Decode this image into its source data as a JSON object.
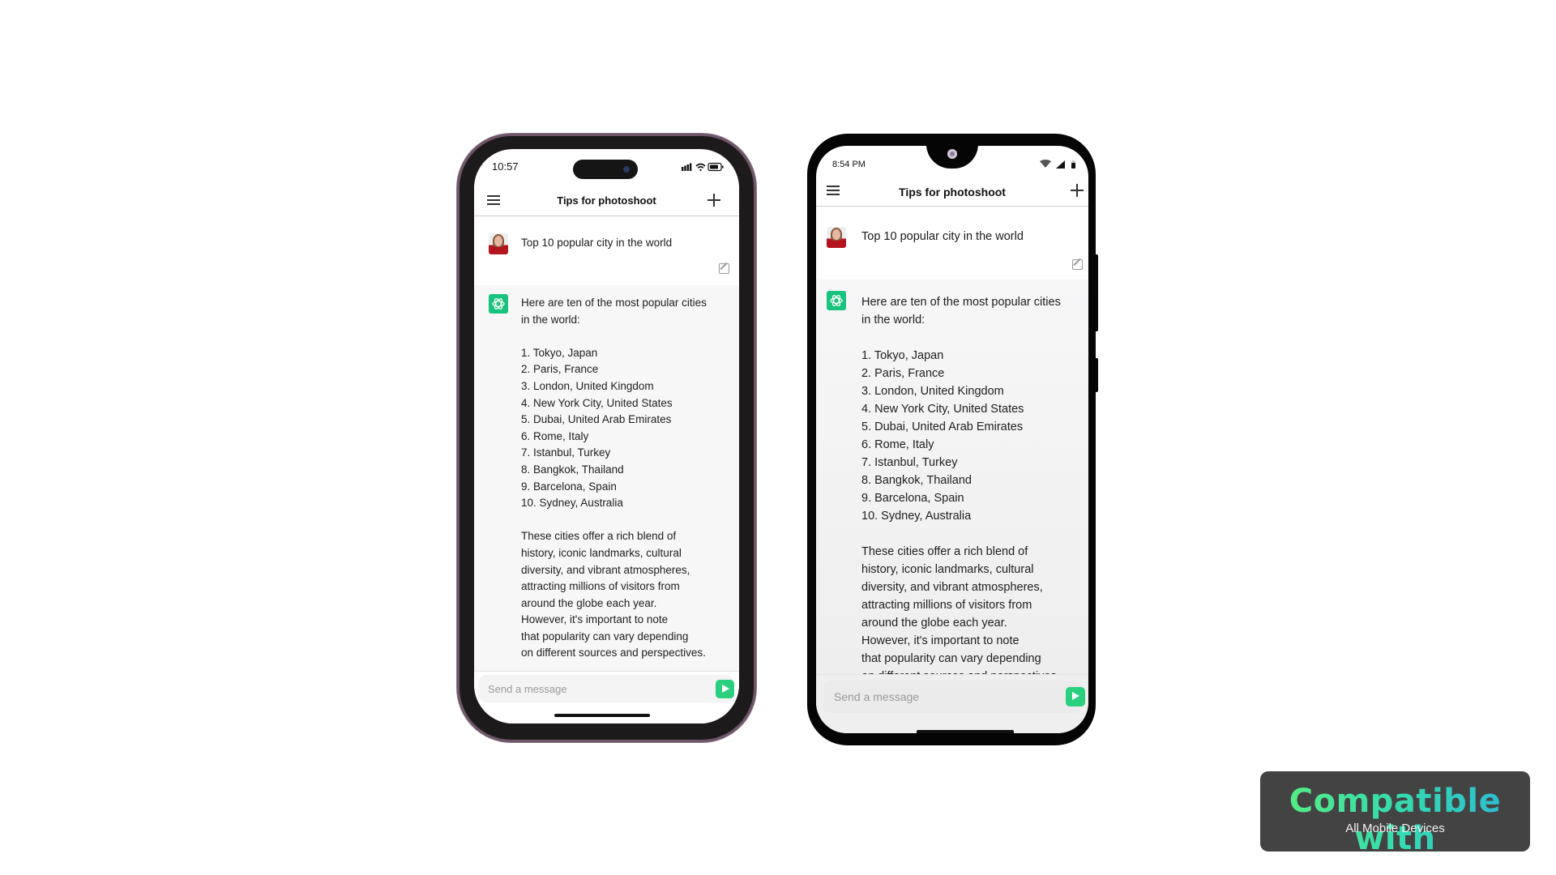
{
  "devices": {
    "iphone": {
      "status": {
        "time": "10:57",
        "icons": [
          "cellular-signal-icon",
          "wifi-icon",
          "battery-icon"
        ]
      },
      "header": {
        "title": "Tips for photoshoot",
        "menu_icon": "hamburger-menu-icon",
        "new_chat_icon": "plus-icon"
      },
      "user_message": "Top 10 popular city in the world",
      "assistant": {
        "intro": [
          "Here are ten of the most popular cities",
          "in the world:"
        ],
        "list": [
          "1. Tokyo, Japan",
          "2. Paris, France",
          "3. London, United Kingdom",
          "4. New York City, United States",
          "5. Dubai, United Arab Emirates",
          "6. Rome, Italy",
          "7. Istanbul, Turkey",
          "8. Bangkok, Thailand",
          "9. Barcelona, Spain",
          "10. Sydney, Australia"
        ],
        "paragraph": [
          "These cities offer a rich blend of",
          "history, iconic landmarks, cultural",
          "diversity, and vibrant atmospheres,",
          "attracting millions of visitors from",
          "around the globe each year.",
          "However, it's important to note",
          "that popularity can vary depending",
          "on different sources and perspectives."
        ]
      },
      "input": {
        "placeholder": "Send a message",
        "value": ""
      }
    },
    "android": {
      "status": {
        "time": "8:54 PM",
        "icons": [
          "wifi-icon",
          "cellular-signal-icon",
          "battery-icon"
        ]
      },
      "header": {
        "title": "Tips for photoshoot",
        "menu_icon": "hamburger-menu-icon",
        "new_chat_icon": "plus-icon"
      },
      "user_message": "Top 10 popular city in the world",
      "assistant": {
        "intro": [
          "Here are ten of the most popular cities",
          "in the world:"
        ],
        "list": [
          "1. Tokyo, Japan",
          "2. Paris, France",
          "3. London, United Kingdom",
          "4. New York City, United States",
          "5. Dubai, United Arab Emirates",
          "6. Rome, Italy",
          "7. Istanbul, Turkey",
          "8. Bangkok, Thailand",
          "9. Barcelona, Spain",
          "10. Sydney, Australia"
        ],
        "paragraph": [
          "These cities offer a rich blend of",
          "history, iconic landmarks, cultural",
          "diversity, and vibrant atmospheres,",
          "attracting millions of visitors from",
          "around the globe each year.",
          "However, it's important to note",
          "that popularity can vary depending",
          "on different sources and perspectives."
        ]
      },
      "input": {
        "placeholder": "Send a message",
        "value": ""
      }
    }
  },
  "badge": {
    "title": "Compatible with",
    "subtitle": "All Mobile Devices",
    "gradient_colors": [
      "#5cf07a",
      "#35dcae",
      "#2bb6d9"
    ],
    "background": "#434343"
  },
  "colors": {
    "accent_green": "#19c37d",
    "send_button": "#2bd07f",
    "iphone_frame": "#6e5568",
    "assistant_bg": "#f7f7f8"
  }
}
